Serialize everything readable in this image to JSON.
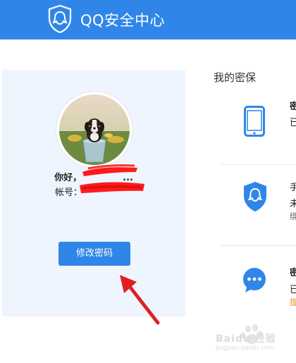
{
  "header": {
    "title": "QQ安全中心",
    "brand_color": "#2f86e8"
  },
  "profile": {
    "greeting_prefix": "你好，",
    "greeting_suffix": "...",
    "account_label": "帐号：",
    "change_password_button": "修改密码"
  },
  "security": {
    "title": "我的密保",
    "items": [
      {
        "icon": "phone-icon",
        "title_char": "密",
        "status_char": "已"
      },
      {
        "icon": "qq-shield-icon",
        "title_char": "手",
        "status_char": "未",
        "sub_char": "绑"
      },
      {
        "icon": "message-icon",
        "title_char": "密",
        "status_char": "已",
        "warn_char": "提"
      }
    ]
  },
  "watermark": {
    "text": "Baidu 经验",
    "url": "jingyan.baidu.com"
  }
}
